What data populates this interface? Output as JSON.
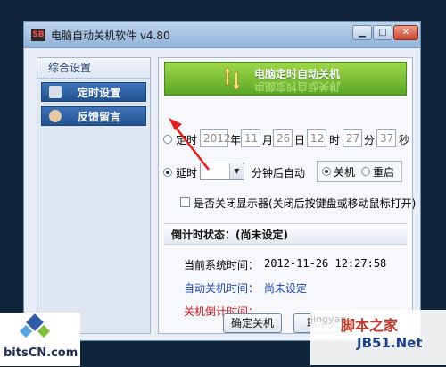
{
  "window": {
    "title": "电脑自动关机软件 v4.80",
    "buttons": [
      "minimize",
      "maximize",
      "close"
    ]
  },
  "sidebar": {
    "header": "综合设置",
    "items": [
      {
        "label": "定时设置",
        "icon": "tools-icon"
      },
      {
        "label": "反馈留言",
        "icon": "user-icon"
      }
    ]
  },
  "banner": {
    "text": "电脑定时自动关机",
    "reflection": "电脑定时自动关机"
  },
  "timed": {
    "label": "定时",
    "selected": false,
    "year": "2012",
    "year_unit": "年",
    "month": "11",
    "month_unit": "月",
    "day": "26",
    "day_unit": "日",
    "hour": "12",
    "hour_unit": "时",
    "minute": "27",
    "minute_unit": "分",
    "second": "37",
    "second_unit": "秒"
  },
  "delay": {
    "label": "延时",
    "selected": true,
    "value": "",
    "after_text": "分钟后自动",
    "shutdown_label": "关机",
    "shutdown_selected": true,
    "restart_label": "重启",
    "restart_selected": false
  },
  "display": {
    "checkbox_label": "是否关闭显示器(关闭后按键盘或移动鼠标打开)",
    "checked": false
  },
  "status": {
    "header": "倒计时状态：(尚未设定)",
    "current_time_label": "当前系统时间：",
    "current_time_value": "2012-11-26 12:27:58",
    "auto_off_label": "自动关机时间：",
    "auto_off_value": "尚未设定",
    "countdown_label": "关机倒计时间："
  },
  "actions": {
    "confirm": "确定关机",
    "cancel": "取消关"
  },
  "watermarks": {
    "right_title": "脚本之家",
    "right_sub": "JB51.Net",
    "right_faint": "jingyan",
    "left": "bitsCN.com"
  },
  "colors": {
    "banner_green": "#5aa625",
    "sidebar_blue": "#23528f",
    "label_blue": "#1a3fb0",
    "label_red": "#d01c1c",
    "arrow_red": "#e0201c"
  }
}
